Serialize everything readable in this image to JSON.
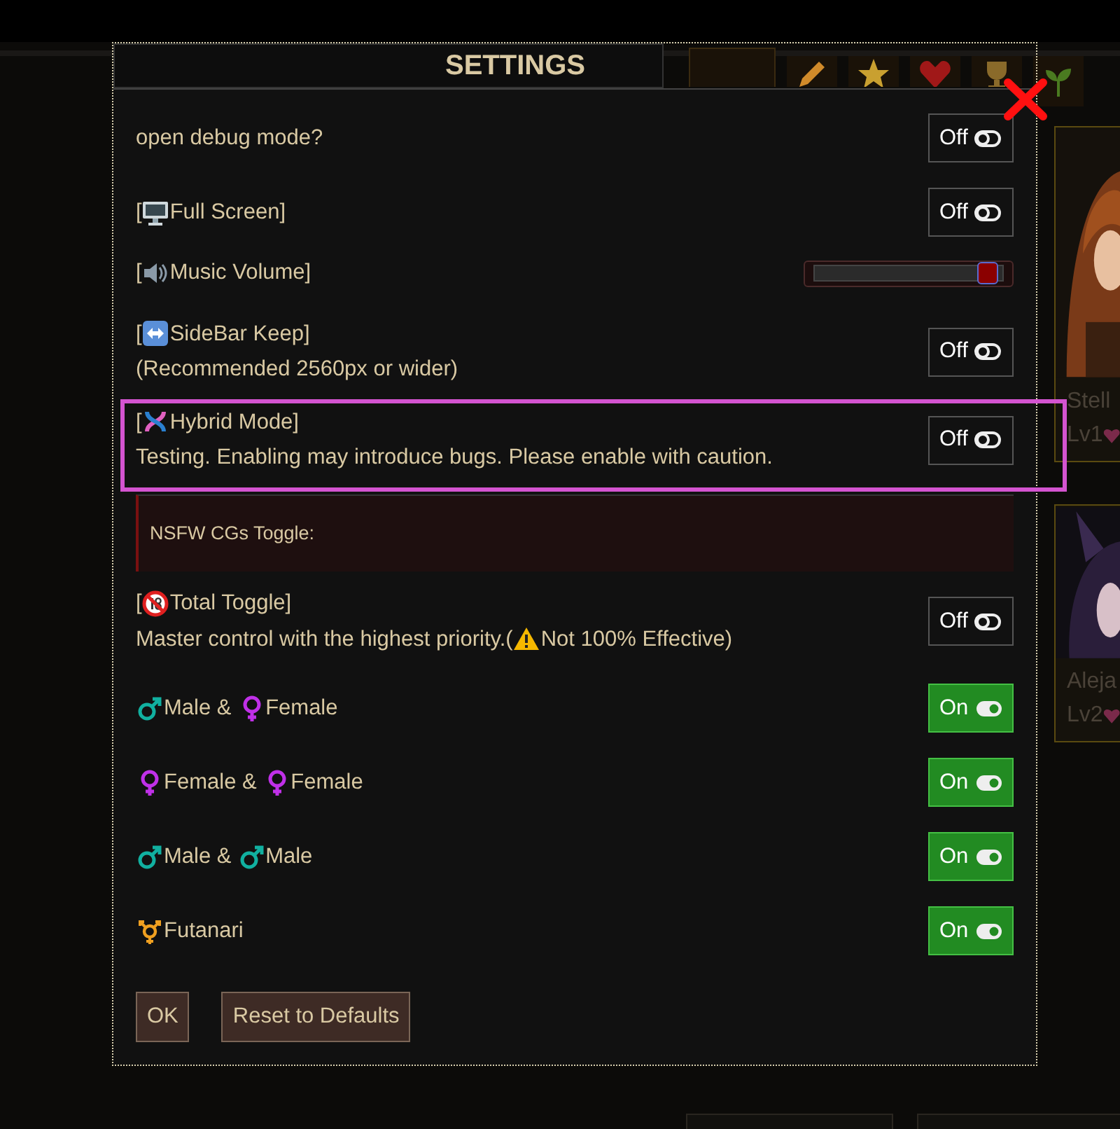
{
  "cards": [
    {
      "name": "Stell",
      "rank": "Lv1"
    },
    {
      "name": "Aleja",
      "rank": "Lv2"
    }
  ],
  "dialog": {
    "title": "SETTINGS",
    "rows": [
      {
        "kind": "toggle",
        "on": false,
        "toggle_label": "Off",
        "highlighted": false,
        "lines": [
          [
            {
              "text": "open debug mode?"
            }
          ]
        ]
      },
      {
        "kind": "toggle",
        "on": false,
        "toggle_label": "Off",
        "highlighted": false,
        "lines": [
          [
            {
              "text": "["
            },
            {
              "text": "Full Screen]",
              "icon": true
            }
          ]
        ]
      },
      {
        "kind": "slider",
        "level": 0.97,
        "lines": [
          [
            {
              "text": "["
            },
            {
              "text": "Music Volume]",
              "icon": true
            }
          ]
        ]
      },
      {
        "kind": "toggle",
        "on": false,
        "toggle_label": "Off",
        "highlighted": false,
        "lines": [
          [
            {
              "text": "["
            },
            {
              "text": "SideBar Keep]",
              "icon": true
            }
          ],
          [
            {
              "text": "(Recommended 2560px or wider)"
            }
          ]
        ]
      },
      {
        "kind": "toggle",
        "on": false,
        "toggle_label": "Off",
        "highlighted": true,
        "lines": [
          [
            {
              "text": "["
            },
            {
              "text": "Hybrid Mode]",
              "icon": true
            }
          ],
          [
            {
              "text": "Testing. Enabling may introduce bugs. Please enable with caution."
            }
          ]
        ]
      },
      {
        "kind": "notice",
        "lines": [
          [
            {
              "text": "NSFW CGs Toggle:"
            }
          ]
        ]
      },
      {
        "kind": "toggle",
        "on": false,
        "toggle_label": "Off",
        "highlighted": false,
        "lines": [
          [
            {
              "text": "["
            },
            {
              "text": "Total Toggle]",
              "icon": true
            }
          ],
          [
            {
              "text": "Master control with the highest priority.("
            },
            {
              "text": "Not 100% Effective)",
              "icon": true
            }
          ]
        ]
      },
      {
        "kind": "toggle",
        "on": true,
        "toggle_label": "On",
        "highlighted": false,
        "lines": [
          [
            {
              "text": "Male & ",
              "icon": true
            },
            {
              "text": "Female",
              "icon": true
            }
          ]
        ]
      },
      {
        "kind": "toggle",
        "on": true,
        "toggle_label": "On",
        "highlighted": false,
        "lines": [
          [
            {
              "text": "Female & ",
              "icon": true
            },
            {
              "text": "Female",
              "icon": true
            }
          ]
        ]
      },
      {
        "kind": "toggle",
        "on": true,
        "toggle_label": "On",
        "highlighted": false,
        "lines": [
          [
            {
              "text": "Male & ",
              "icon": true
            },
            {
              "text": "Male",
              "icon": true
            }
          ]
        ]
      },
      {
        "kind": "toggle",
        "on": true,
        "toggle_label": "On",
        "highlighted": false,
        "lines": [
          [
            {
              "text": "Futanari",
              "icon": true
            }
          ]
        ]
      }
    ],
    "buttons": [
      {
        "label": "OK"
      },
      {
        "label": "Reset to Defaults"
      }
    ]
  }
}
